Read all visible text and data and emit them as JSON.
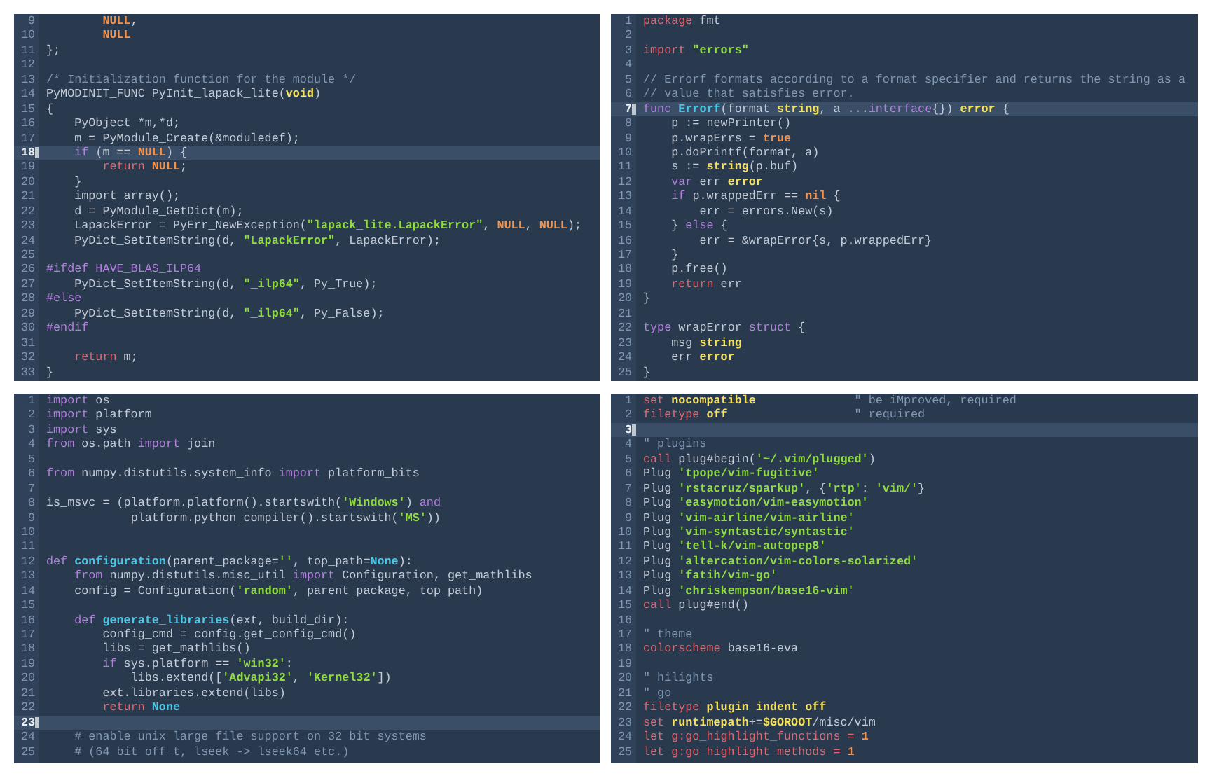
{
  "panes": [
    {
      "lines": [
        {
          "number": "9",
          "current": false,
          "tokens": [
            {
              "kind": "constant",
              "text": "        NULL"
            },
            {
              "kind": "plain",
              "text": ","
            }
          ]
        },
        {
          "number": "10",
          "current": false,
          "tokens": [
            {
              "kind": "constant",
              "text": "        NULL"
            }
          ]
        },
        {
          "number": "11",
          "current": false,
          "tokens": [
            {
              "kind": "plain",
              "text": "};"
            }
          ]
        },
        {
          "number": "12",
          "current": false
        },
        {
          "number": "13",
          "current": false,
          "tokens": [
            {
              "kind": "comment",
              "text": "/* Initialization function for the module */"
            }
          ]
        },
        {
          "number": "14",
          "current": false,
          "tokens": [
            {
              "kind": "plain",
              "text": "PyMODINIT_FUNC PyInit_lapack_lite("
            },
            {
              "kind": "type",
              "text": "void"
            },
            {
              "kind": "plain",
              "text": ")"
            }
          ]
        },
        {
          "number": "15",
          "current": false,
          "tokens": [
            {
              "kind": "plain",
              "text": "{"
            }
          ]
        },
        {
          "number": "16",
          "current": false,
          "tokens": [
            {
              "kind": "plain",
              "text": "    PyObject *m,*d;"
            }
          ]
        },
        {
          "number": "17",
          "current": false,
          "tokens": [
            {
              "kind": "plain",
              "text": "    m = PyModule_Create(&moduledef);"
            }
          ]
        },
        {
          "number": "18",
          "current": true,
          "tokens": [
            {
              "kind": "keyword",
              "text": "    if"
            },
            {
              "kind": "plain",
              "text": " (m == "
            },
            {
              "kind": "constant",
              "text": "NULL"
            },
            {
              "kind": "plain",
              "text": ") {"
            }
          ]
        },
        {
          "number": "19",
          "current": false,
          "tokens": [
            {
              "kind": "control",
              "text": "        return"
            },
            {
              "kind": "constant",
              "text": " NULL"
            },
            {
              "kind": "plain",
              "text": ";"
            }
          ]
        },
        {
          "number": "20",
          "current": false,
          "tokens": [
            {
              "kind": "plain",
              "text": "    }"
            }
          ]
        },
        {
          "number": "21",
          "current": false,
          "tokens": [
            {
              "kind": "plain",
              "text": "    import_array();"
            }
          ]
        },
        {
          "number": "22",
          "current": false,
          "tokens": [
            {
              "kind": "plain",
              "text": "    d = PyModule_GetDict(m);"
            }
          ]
        },
        {
          "number": "23",
          "current": false,
          "tokens": [
            {
              "kind": "plain",
              "text": "    LapackError = PyErr_NewException("
            },
            {
              "kind": "string",
              "text": "\"lapack_lite.LapackError\""
            },
            {
              "kind": "plain",
              "text": ", "
            },
            {
              "kind": "constant",
              "text": "NULL"
            },
            {
              "kind": "plain",
              "text": ", "
            },
            {
              "kind": "constant",
              "text": "NULL"
            },
            {
              "kind": "plain",
              "text": ");"
            }
          ]
        },
        {
          "number": "24",
          "current": false,
          "tokens": [
            {
              "kind": "plain",
              "text": "    PyDict_SetItemString(d, "
            },
            {
              "kind": "string",
              "text": "\"LapackError\""
            },
            {
              "kind": "plain",
              "text": ", LapackError);"
            }
          ]
        },
        {
          "number": "25",
          "current": false
        },
        {
          "number": "26",
          "current": false,
          "tokens": [
            {
              "kind": "keyword",
              "text": "#ifdef HAVE_BLAS_ILP64"
            }
          ]
        },
        {
          "number": "27",
          "current": false,
          "tokens": [
            {
              "kind": "plain",
              "text": "    PyDict_SetItemString(d, "
            },
            {
              "kind": "string",
              "text": "\"_ilp64\""
            },
            {
              "kind": "plain",
              "text": ", Py_True);"
            }
          ]
        },
        {
          "number": "28",
          "current": false,
          "tokens": [
            {
              "kind": "keyword",
              "text": "#else"
            }
          ]
        },
        {
          "number": "29",
          "current": false,
          "tokens": [
            {
              "kind": "plain",
              "text": "    PyDict_SetItemString(d, "
            },
            {
              "kind": "string",
              "text": "\"_ilp64\""
            },
            {
              "kind": "plain",
              "text": ", Py_False);"
            }
          ]
        },
        {
          "number": "30",
          "current": false,
          "tokens": [
            {
              "kind": "keyword",
              "text": "#endif"
            }
          ]
        },
        {
          "number": "31",
          "current": false
        },
        {
          "number": "32",
          "current": false,
          "tokens": [
            {
              "kind": "control",
              "text": "    return"
            },
            {
              "kind": "plain",
              "text": " m;"
            }
          ]
        },
        {
          "number": "33",
          "current": false,
          "tokens": [
            {
              "kind": "plain",
              "text": "}"
            }
          ]
        }
      ]
    },
    {
      "lines": [
        {
          "number": "1",
          "current": false,
          "tokens": [
            {
              "kind": "control",
              "text": "package"
            },
            {
              "kind": "plain",
              "text": " fmt"
            }
          ]
        },
        {
          "number": "2",
          "current": false
        },
        {
          "number": "3",
          "current": false,
          "tokens": [
            {
              "kind": "control",
              "text": "import"
            },
            {
              "kind": "string",
              "text": " \"errors\""
            }
          ]
        },
        {
          "number": "4",
          "current": false
        },
        {
          "number": "5",
          "current": false,
          "tokens": [
            {
              "kind": "comment",
              "text": "// Errorf formats according to a format specifier and returns the string as a"
            }
          ]
        },
        {
          "number": "6",
          "current": false,
          "tokens": [
            {
              "kind": "comment",
              "text": "// value that satisfies error."
            }
          ]
        },
        {
          "number": "7",
          "current": true,
          "tokens": [
            {
              "kind": "keyword",
              "text": "func"
            },
            {
              "kind": "function",
              "text": " Errorf"
            },
            {
              "kind": "plain",
              "text": "(format "
            },
            {
              "kind": "type",
              "text": "string"
            },
            {
              "kind": "plain",
              "text": ", a ..."
            },
            {
              "kind": "keyword",
              "text": "interface"
            },
            {
              "kind": "plain",
              "text": "{}) "
            },
            {
              "kind": "type",
              "text": "error"
            },
            {
              "kind": "plain",
              "text": " {"
            }
          ]
        },
        {
          "number": "8",
          "current": false,
          "tokens": [
            {
              "kind": "plain",
              "text": "    p := newPrinter()"
            }
          ]
        },
        {
          "number": "9",
          "current": false,
          "tokens": [
            {
              "kind": "plain",
              "text": "    p.wrapErrs = "
            },
            {
              "kind": "constant",
              "text": "true"
            }
          ]
        },
        {
          "number": "10",
          "current": false,
          "tokens": [
            {
              "kind": "plain",
              "text": "    p.doPrintf(format, a)"
            }
          ]
        },
        {
          "number": "11",
          "current": false,
          "tokens": [
            {
              "kind": "plain",
              "text": "    s := "
            },
            {
              "kind": "type",
              "text": "string"
            },
            {
              "kind": "plain",
              "text": "(p.buf)"
            }
          ]
        },
        {
          "number": "12",
          "current": false,
          "tokens": [
            {
              "kind": "keyword",
              "text": "    var"
            },
            {
              "kind": "plain",
              "text": " err "
            },
            {
              "kind": "type",
              "text": "error"
            }
          ]
        },
        {
          "number": "13",
          "current": false,
          "tokens": [
            {
              "kind": "keyword",
              "text": "    if"
            },
            {
              "kind": "plain",
              "text": " p.wrappedErr == "
            },
            {
              "kind": "constant",
              "text": "nil"
            },
            {
              "kind": "plain",
              "text": " {"
            }
          ]
        },
        {
          "number": "14",
          "current": false,
          "tokens": [
            {
              "kind": "plain",
              "text": "        err = errors.New(s)"
            }
          ]
        },
        {
          "number": "15",
          "current": false,
          "tokens": [
            {
              "kind": "plain",
              "text": "    } "
            },
            {
              "kind": "keyword",
              "text": "else"
            },
            {
              "kind": "plain",
              "text": " {"
            }
          ]
        },
        {
          "number": "16",
          "current": false,
          "tokens": [
            {
              "kind": "plain",
              "text": "        err = &wrapError{s, p.wrappedErr}"
            }
          ]
        },
        {
          "number": "17",
          "current": false,
          "tokens": [
            {
              "kind": "plain",
              "text": "    }"
            }
          ]
        },
        {
          "number": "18",
          "current": false,
          "tokens": [
            {
              "kind": "plain",
              "text": "    p.free()"
            }
          ]
        },
        {
          "number": "19",
          "current": false,
          "tokens": [
            {
              "kind": "control",
              "text": "    return"
            },
            {
              "kind": "plain",
              "text": " err"
            }
          ]
        },
        {
          "number": "20",
          "current": false,
          "tokens": [
            {
              "kind": "plain",
              "text": "}"
            }
          ]
        },
        {
          "number": "21",
          "current": false
        },
        {
          "number": "22",
          "current": false,
          "tokens": [
            {
              "kind": "keyword",
              "text": "type"
            },
            {
              "kind": "plain",
              "text": " wrapError "
            },
            {
              "kind": "keyword",
              "text": "struct"
            },
            {
              "kind": "plain",
              "text": " {"
            }
          ]
        },
        {
          "number": "23",
          "current": false,
          "tokens": [
            {
              "kind": "plain",
              "text": "    msg "
            },
            {
              "kind": "type",
              "text": "string"
            }
          ]
        },
        {
          "number": "24",
          "current": false,
          "tokens": [
            {
              "kind": "plain",
              "text": "    err "
            },
            {
              "kind": "type",
              "text": "error"
            }
          ]
        },
        {
          "number": "25",
          "current": false,
          "tokens": [
            {
              "kind": "plain",
              "text": "}"
            }
          ]
        }
      ]
    },
    {
      "lines": [
        {
          "number": "1",
          "current": false,
          "tokens": [
            {
              "kind": "keyword",
              "text": "import"
            },
            {
              "kind": "plain",
              "text": " os"
            }
          ]
        },
        {
          "number": "2",
          "current": false,
          "tokens": [
            {
              "kind": "keyword",
              "text": "import"
            },
            {
              "kind": "plain",
              "text": " platform"
            }
          ]
        },
        {
          "number": "3",
          "current": false,
          "tokens": [
            {
              "kind": "keyword",
              "text": "import"
            },
            {
              "kind": "plain",
              "text": " sys"
            }
          ]
        },
        {
          "number": "4",
          "current": false,
          "tokens": [
            {
              "kind": "keyword",
              "text": "from"
            },
            {
              "kind": "plain",
              "text": " os.path "
            },
            {
              "kind": "keyword",
              "text": "import"
            },
            {
              "kind": "plain",
              "text": " join"
            }
          ]
        },
        {
          "number": "5",
          "current": false
        },
        {
          "number": "6",
          "current": false,
          "tokens": [
            {
              "kind": "keyword",
              "text": "from"
            },
            {
              "kind": "plain",
              "text": " numpy.distutils.system_info "
            },
            {
              "kind": "keyword",
              "text": "import"
            },
            {
              "kind": "plain",
              "text": " platform_bits"
            }
          ]
        },
        {
          "number": "7",
          "current": false
        },
        {
          "number": "8",
          "current": false,
          "tokens": [
            {
              "kind": "plain",
              "text": "is_msvc = (platform.platform().startswith("
            },
            {
              "kind": "string",
              "text": "'Windows'"
            },
            {
              "kind": "plain",
              "text": ") "
            },
            {
              "kind": "keyword",
              "text": "and"
            }
          ]
        },
        {
          "number": "9",
          "current": false,
          "tokens": [
            {
              "kind": "plain",
              "text": "            platform.python_compiler().startswith("
            },
            {
              "kind": "string",
              "text": "'MS'"
            },
            {
              "kind": "plain",
              "text": "))"
            }
          ]
        },
        {
          "number": "10",
          "current": false
        },
        {
          "number": "11",
          "current": false
        },
        {
          "number": "12",
          "current": false,
          "tokens": [
            {
              "kind": "keyword",
              "text": "def"
            },
            {
              "kind": "function",
              "text": " configuration"
            },
            {
              "kind": "plain",
              "text": "(parent_package="
            },
            {
              "kind": "string",
              "text": "''"
            },
            {
              "kind": "plain",
              "text": ", top_path="
            },
            {
              "kind": "builtin",
              "text": "None"
            },
            {
              "kind": "plain",
              "text": "):"
            }
          ]
        },
        {
          "number": "13",
          "current": false,
          "tokens": [
            {
              "kind": "keyword",
              "text": "    from"
            },
            {
              "kind": "plain",
              "text": " numpy.distutils.misc_util "
            },
            {
              "kind": "keyword",
              "text": "import"
            },
            {
              "kind": "plain",
              "text": " Configuration, get_mathlibs"
            }
          ]
        },
        {
          "number": "14",
          "current": false,
          "tokens": [
            {
              "kind": "plain",
              "text": "    config = Configuration("
            },
            {
              "kind": "string",
              "text": "'random'"
            },
            {
              "kind": "plain",
              "text": ", parent_package, top_path)"
            }
          ]
        },
        {
          "number": "15",
          "current": false
        },
        {
          "number": "16",
          "current": false,
          "tokens": [
            {
              "kind": "keyword",
              "text": "    def"
            },
            {
              "kind": "function",
              "text": " generate_libraries"
            },
            {
              "kind": "plain",
              "text": "(ext, build_dir):"
            }
          ]
        },
        {
          "number": "17",
          "current": false,
          "tokens": [
            {
              "kind": "plain",
              "text": "        config_cmd = config.get_config_cmd()"
            }
          ]
        },
        {
          "number": "18",
          "current": false,
          "tokens": [
            {
              "kind": "plain",
              "text": "        libs = get_mathlibs()"
            }
          ]
        },
        {
          "number": "19",
          "current": false,
          "tokens": [
            {
              "kind": "keyword",
              "text": "        if"
            },
            {
              "kind": "plain",
              "text": " sys.platform == "
            },
            {
              "kind": "string",
              "text": "'win32'"
            },
            {
              "kind": "plain",
              "text": ":"
            }
          ]
        },
        {
          "number": "20",
          "current": false,
          "tokens": [
            {
              "kind": "plain",
              "text": "            libs.extend(["
            },
            {
              "kind": "string",
              "text": "'Advapi32'"
            },
            {
              "kind": "plain",
              "text": ", "
            },
            {
              "kind": "string",
              "text": "'Kernel32'"
            },
            {
              "kind": "plain",
              "text": "])"
            }
          ]
        },
        {
          "number": "21",
          "current": false,
          "tokens": [
            {
              "kind": "plain",
              "text": "        ext.libraries.extend(libs)"
            }
          ]
        },
        {
          "number": "22",
          "current": false,
          "tokens": [
            {
              "kind": "control",
              "text": "        return"
            },
            {
              "kind": "builtin",
              "text": " None"
            }
          ]
        },
        {
          "number": "23",
          "current": true
        },
        {
          "number": "24",
          "current": false,
          "tokens": [
            {
              "kind": "comment",
              "text": "    # enable unix large file support on 32 bit systems"
            }
          ]
        },
        {
          "number": "25",
          "current": false,
          "tokens": [
            {
              "kind": "comment",
              "text": "    # (64 bit off_t, lseek -> lseek64 etc.)"
            }
          ]
        }
      ]
    },
    {
      "lines": [
        {
          "number": "1",
          "current": false,
          "tokens": [
            {
              "kind": "control",
              "text": "set"
            },
            {
              "kind": "type",
              "text": " nocompatible"
            },
            {
              "kind": "comment",
              "text": "              \" be iMproved, required"
            }
          ]
        },
        {
          "number": "2",
          "current": false,
          "tokens": [
            {
              "kind": "control",
              "text": "filetype"
            },
            {
              "kind": "type",
              "text": " off"
            },
            {
              "kind": "comment",
              "text": "                  \" required"
            }
          ]
        },
        {
          "number": "3",
          "current": true
        },
        {
          "number": "4",
          "current": false,
          "tokens": [
            {
              "kind": "comment",
              "text": "\" plugins"
            }
          ]
        },
        {
          "number": "5",
          "current": false,
          "tokens": [
            {
              "kind": "control",
              "text": "call"
            },
            {
              "kind": "plain",
              "text": " plug#begin("
            },
            {
              "kind": "string",
              "text": "'~/.vim/plugged'"
            },
            {
              "kind": "plain",
              "text": ")"
            }
          ]
        },
        {
          "number": "6",
          "current": false,
          "tokens": [
            {
              "kind": "plain",
              "text": "Plug "
            },
            {
              "kind": "string",
              "text": "'tpope/vim-fugitive'"
            }
          ]
        },
        {
          "number": "7",
          "current": false,
          "tokens": [
            {
              "kind": "plain",
              "text": "Plug "
            },
            {
              "kind": "string",
              "text": "'rstacruz/sparkup'"
            },
            {
              "kind": "plain",
              "text": ", {"
            },
            {
              "kind": "string",
              "text": "'rtp'"
            },
            {
              "kind": "plain",
              "text": ": "
            },
            {
              "kind": "string",
              "text": "'vim/'"
            },
            {
              "kind": "plain",
              "text": "}"
            }
          ]
        },
        {
          "number": "8",
          "current": false,
          "tokens": [
            {
              "kind": "plain",
              "text": "Plug "
            },
            {
              "kind": "string",
              "text": "'easymotion/vim-easymotion'"
            }
          ]
        },
        {
          "number": "9",
          "current": false,
          "tokens": [
            {
              "kind": "plain",
              "text": "Plug "
            },
            {
              "kind": "string",
              "text": "'vim-airline/vim-airline'"
            }
          ]
        },
        {
          "number": "10",
          "current": false,
          "tokens": [
            {
              "kind": "plain",
              "text": "Plug "
            },
            {
              "kind": "string",
              "text": "'vim-syntastic/syntastic'"
            }
          ]
        },
        {
          "number": "11",
          "current": false,
          "tokens": [
            {
              "kind": "plain",
              "text": "Plug "
            },
            {
              "kind": "string",
              "text": "'tell-k/vim-autopep8'"
            }
          ]
        },
        {
          "number": "12",
          "current": false,
          "tokens": [
            {
              "kind": "plain",
              "text": "Plug "
            },
            {
              "kind": "string",
              "text": "'altercation/vim-colors-solarized'"
            }
          ]
        },
        {
          "number": "13",
          "current": false,
          "tokens": [
            {
              "kind": "plain",
              "text": "Plug "
            },
            {
              "kind": "string",
              "text": "'fatih/vim-go'"
            }
          ]
        },
        {
          "number": "14",
          "current": false,
          "tokens": [
            {
              "kind": "plain",
              "text": "Plug "
            },
            {
              "kind": "string",
              "text": "'chriskempson/base16-vim'"
            }
          ]
        },
        {
          "number": "15",
          "current": false,
          "tokens": [
            {
              "kind": "control",
              "text": "call"
            },
            {
              "kind": "plain",
              "text": " plug#end()"
            }
          ]
        },
        {
          "number": "16",
          "current": false
        },
        {
          "number": "17",
          "current": false,
          "tokens": [
            {
              "kind": "comment",
              "text": "\" theme"
            }
          ]
        },
        {
          "number": "18",
          "current": false,
          "tokens": [
            {
              "kind": "control",
              "text": "colorscheme"
            },
            {
              "kind": "plain",
              "text": " base16-eva"
            }
          ]
        },
        {
          "number": "19",
          "current": false
        },
        {
          "number": "20",
          "current": false,
          "tokens": [
            {
              "kind": "comment",
              "text": "\" hilights"
            }
          ]
        },
        {
          "number": "21",
          "current": false,
          "tokens": [
            {
              "kind": "comment",
              "text": "\" go"
            }
          ]
        },
        {
          "number": "22",
          "current": false,
          "tokens": [
            {
              "kind": "control",
              "text": "filetype"
            },
            {
              "kind": "type",
              "text": " plugin indent off"
            }
          ]
        },
        {
          "number": "23",
          "current": false,
          "tokens": [
            {
              "kind": "control",
              "text": "set"
            },
            {
              "kind": "type",
              "text": " runtimepath"
            },
            {
              "kind": "plain",
              "text": "+="
            },
            {
              "kind": "type",
              "text": "$GOROOT"
            },
            {
              "kind": "plain",
              "text": "/misc/vim"
            }
          ]
        },
        {
          "number": "24",
          "current": false,
          "tokens": [
            {
              "kind": "control",
              "text": "let g:go_highlight_functions = "
            },
            {
              "kind": "constant",
              "text": "1"
            }
          ]
        },
        {
          "number": "25",
          "current": false,
          "tokens": [
            {
              "kind": "control",
              "text": "let g:go_highlight_methods = "
            },
            {
              "kind": "constant",
              "text": "1"
            }
          ]
        }
      ]
    }
  ]
}
